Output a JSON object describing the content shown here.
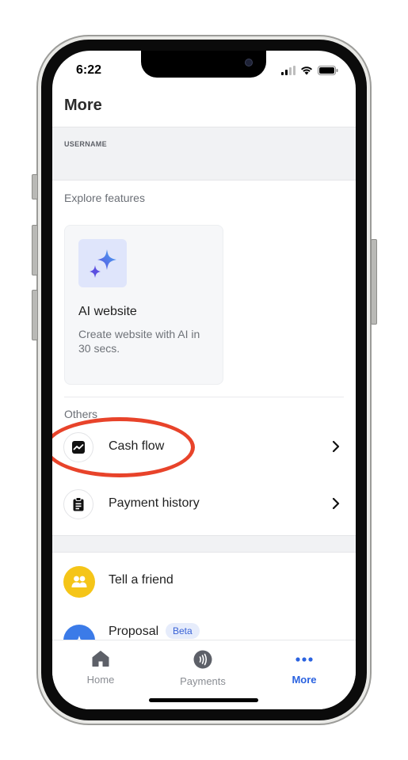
{
  "status_bar": {
    "time": "6:22"
  },
  "header": {
    "title": "More"
  },
  "account": {
    "username_label": "USERNAME"
  },
  "explore": {
    "section_label": "Explore features",
    "feature_card": {
      "title": "AI website",
      "description": "Create website with AI in 30 secs.",
      "icon": "sparkle-icon"
    }
  },
  "others": {
    "section_label": "Others",
    "items": [
      {
        "label": "Cash flow",
        "icon": "chart-icon"
      },
      {
        "label": "Payment history",
        "icon": "clipboard-icon"
      }
    ]
  },
  "extras": {
    "items": [
      {
        "label": "Tell a friend",
        "icon": "people-icon",
        "color": "#f5c518"
      },
      {
        "label": "Proposal",
        "badge": "Beta",
        "icon": "star-icon",
        "color": "#3b7be8"
      }
    ]
  },
  "tabbar": {
    "tabs": [
      {
        "label": "Home",
        "icon": "home-icon"
      },
      {
        "label": "Payments",
        "icon": "contactless-icon"
      },
      {
        "label": "More",
        "icon": "more-dots-icon",
        "active": true
      }
    ],
    "active_color": "#2b63e0"
  },
  "annotation": {
    "highlight_color": "#e8432a"
  }
}
